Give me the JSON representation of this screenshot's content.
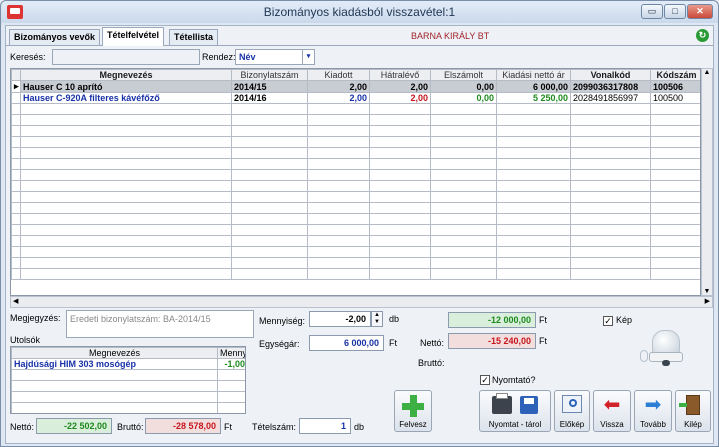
{
  "window": {
    "title": "Bizományos kiadásból visszavétel:1",
    "min": "▭",
    "max": "□",
    "close": "✕"
  },
  "tabs": [
    "Bizományos vevők",
    "Tételfelvétel",
    "Tétellista"
  ],
  "active_tab": "Tételfelvétel",
  "company": "BARNA KIRÁLY BT",
  "search": {
    "label": "Keresés:",
    "value": ""
  },
  "sort": {
    "label": "Rendez:",
    "value": "Név"
  },
  "grid": {
    "columns": [
      "Megnevezés",
      "Bizonylatszám",
      "Kiadott",
      "Hátralévő",
      "Elszámolt",
      "Kiadási nettó ár",
      "Vonalkód",
      "Kódszám"
    ],
    "rows": [
      {
        "marker": "▸",
        "name": "Hauser C 10 aprító",
        "doc": "2014/15",
        "issued": "2,00",
        "remaining": "2,00",
        "settled": "0,00",
        "price": "6 000,00",
        "barcode": "2099036317808",
        "code": "100506"
      },
      {
        "marker": "",
        "name": "Hauser C-920A filteres kávéfőző",
        "doc": "2014/16",
        "issued": "2,00",
        "remaining": "2,00",
        "settled": "0,00",
        "price": "5 250,00",
        "barcode": "2028491856997",
        "code": "100500"
      }
    ]
  },
  "note": {
    "label": "Megjegyzés:",
    "value": "Eredeti bizonylatszám: BA-2014/15"
  },
  "last": {
    "label": "Utolsók",
    "columns": [
      "Megnevezés",
      "Mennyi"
    ],
    "rows": [
      {
        "name": "Hajdúsági HIM 303 mosógép",
        "qty": "-1,00"
      }
    ]
  },
  "quantity": {
    "label": "Mennyiség:",
    "value": "-2,00",
    "unit": "db"
  },
  "unit_price": {
    "label": "Egységár:",
    "value": "6 000,00",
    "unit": "Ft"
  },
  "total1": {
    "value": "-12 000,00",
    "unit": "Ft"
  },
  "netto_right": {
    "label": "Nettó:",
    "value": "-15 240,00",
    "unit": "Ft"
  },
  "brutto_right": {
    "label": "Bruttó:"
  },
  "kep": {
    "label": "Kép",
    "checked": true
  },
  "nyomtato": {
    "label": "Nyomtató?",
    "checked": true
  },
  "footer": {
    "netto_label": "Nettó:",
    "netto": "-22 502,00",
    "brutto_label": "Bruttó:",
    "brutto": "-28 578,00",
    "ft": "Ft",
    "count_label": "Tételszám:",
    "count": "1",
    "count_unit": "db"
  },
  "buttons": {
    "felvesz": "Felvesz",
    "print": "Nyomtat - tárol",
    "preview": "Előkép",
    "back": "Vissza",
    "next": "Tovább",
    "exit": "Kilép"
  }
}
